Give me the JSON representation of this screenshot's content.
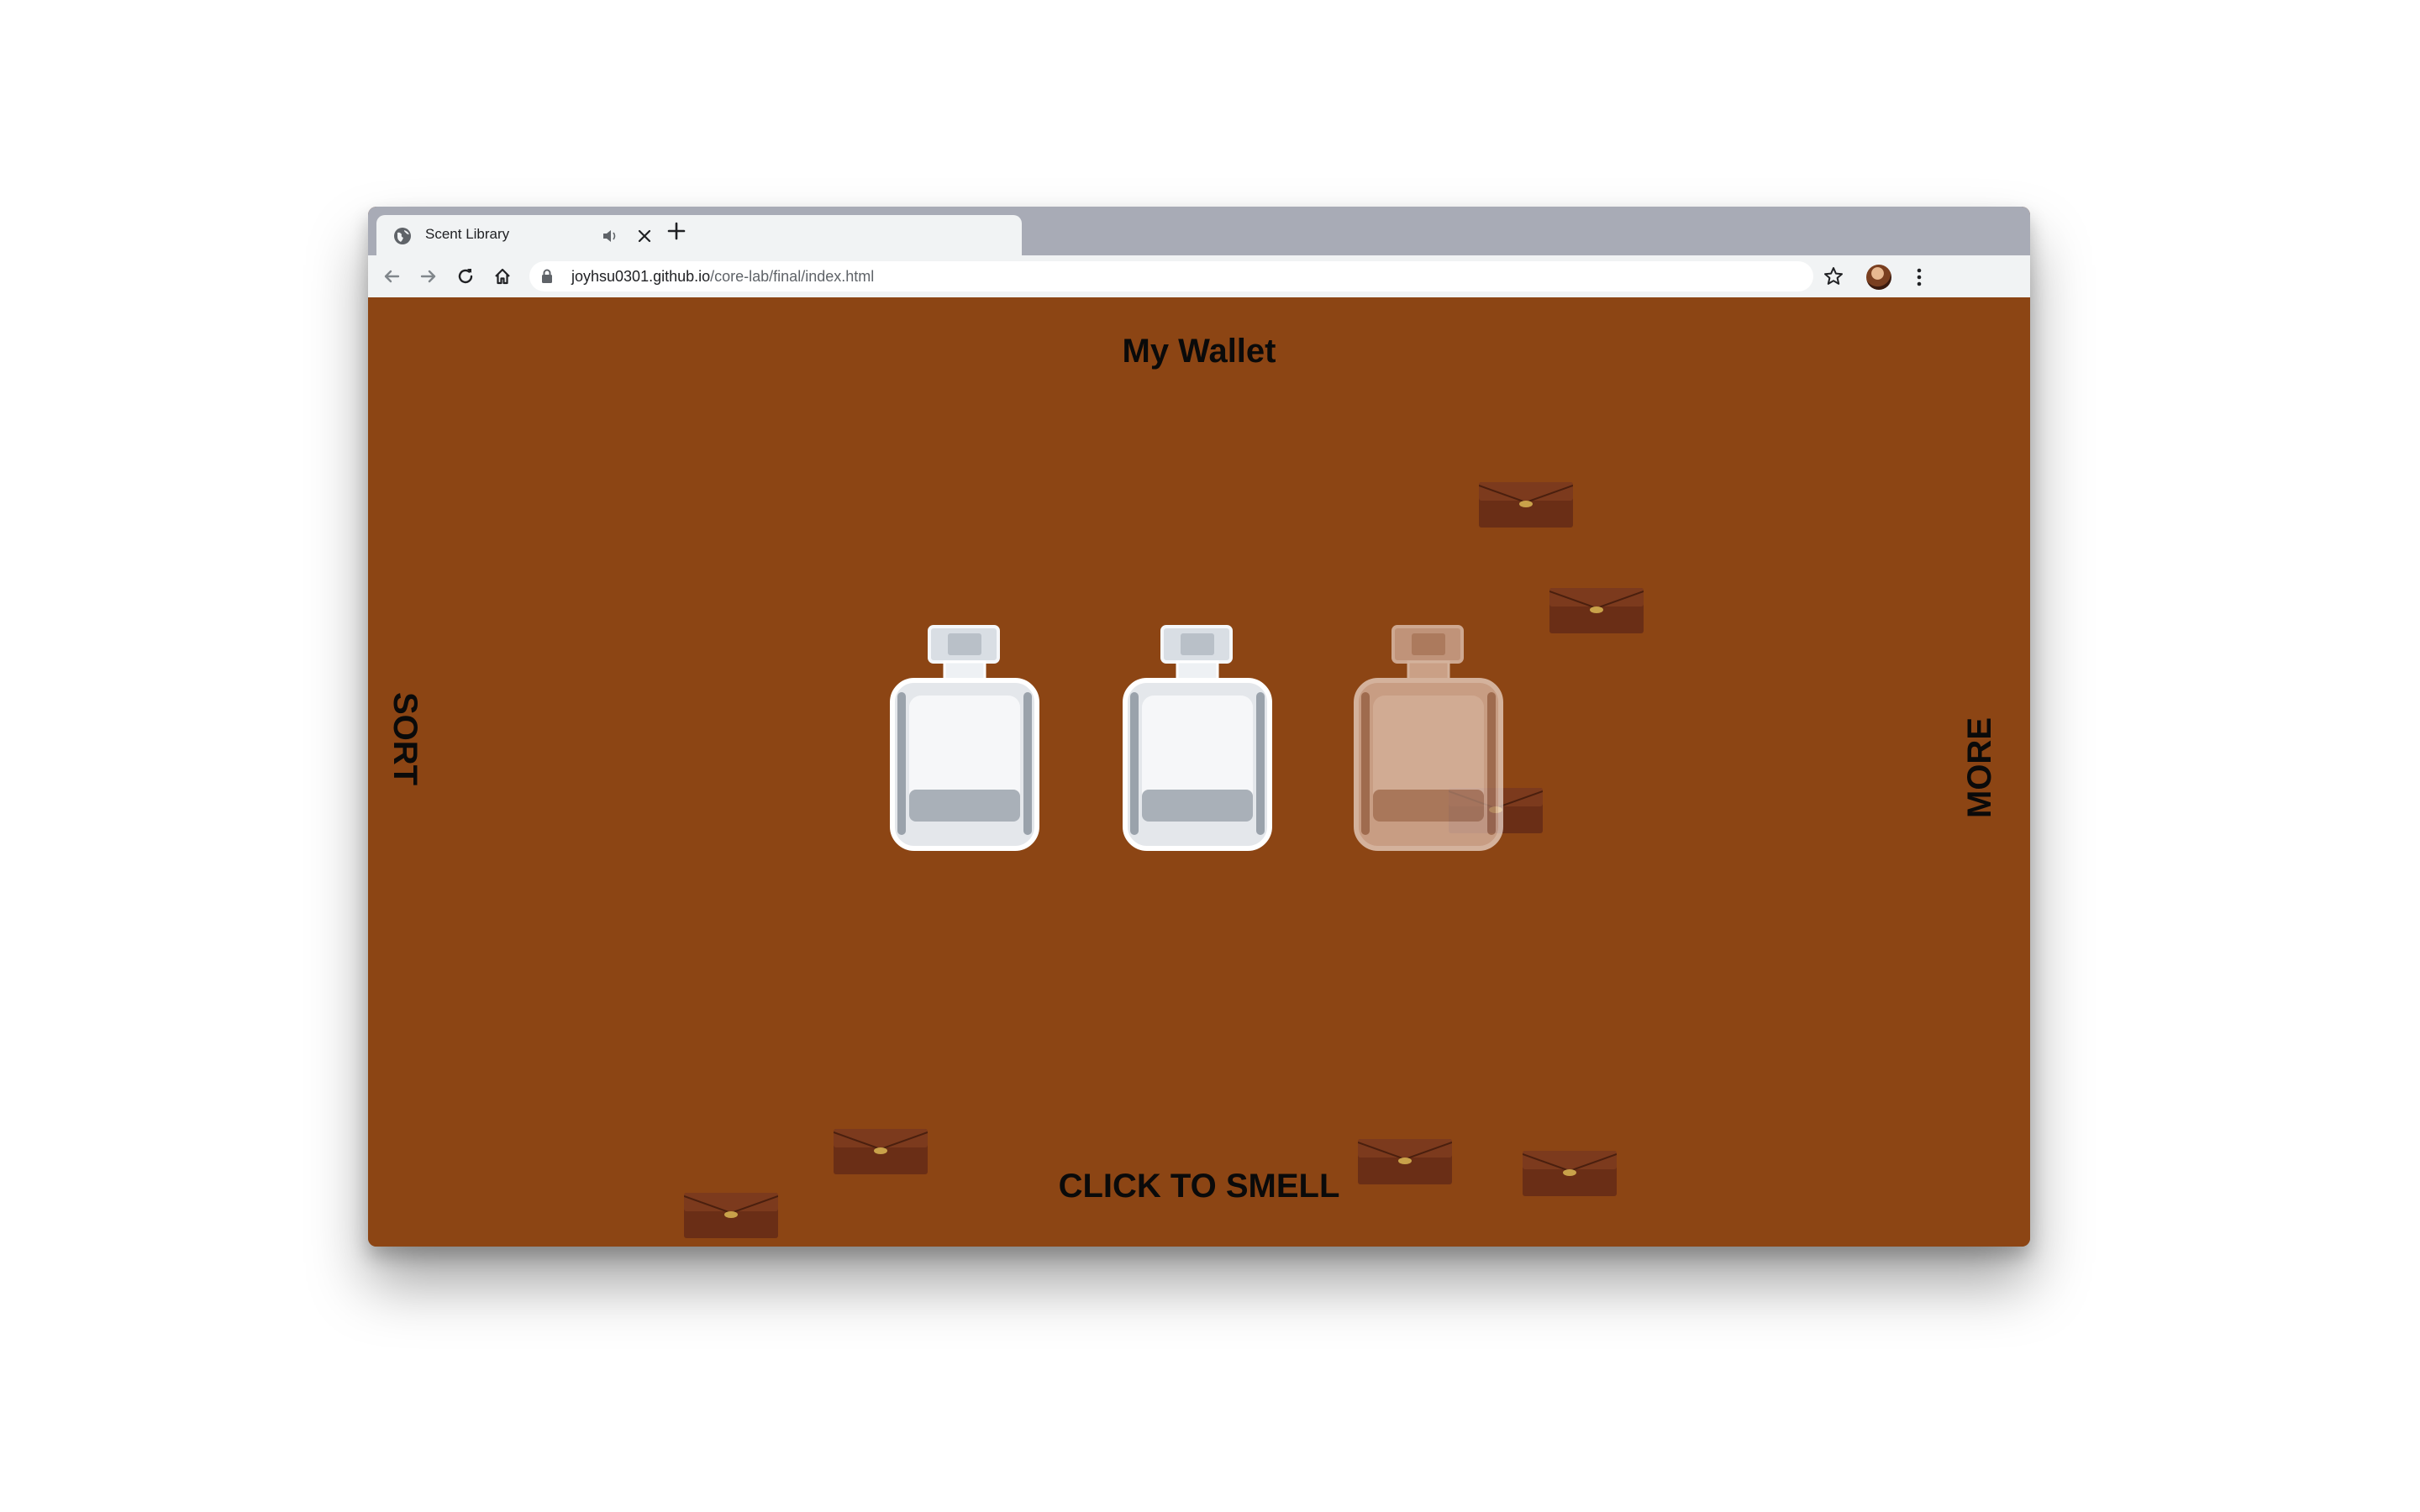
{
  "browser": {
    "tab": {
      "title": "Scent Library"
    },
    "address": {
      "host": "joyhsu0301.github.io",
      "path": "/core-lab/final/index.html"
    }
  },
  "page": {
    "title": "My Wallet",
    "left_nav": "SORT",
    "right_nav": "MORE",
    "cta": "CLICK TO SMELL"
  },
  "colors": {
    "page_background": "#8c4514",
    "tab_strip": "#a8abb6",
    "toolbar": "#f1f3f4",
    "text": "#0a0a0a"
  },
  "bottles": [
    {
      "tint": "clear"
    },
    {
      "tint": "clear"
    },
    {
      "tint": "blush"
    }
  ]
}
